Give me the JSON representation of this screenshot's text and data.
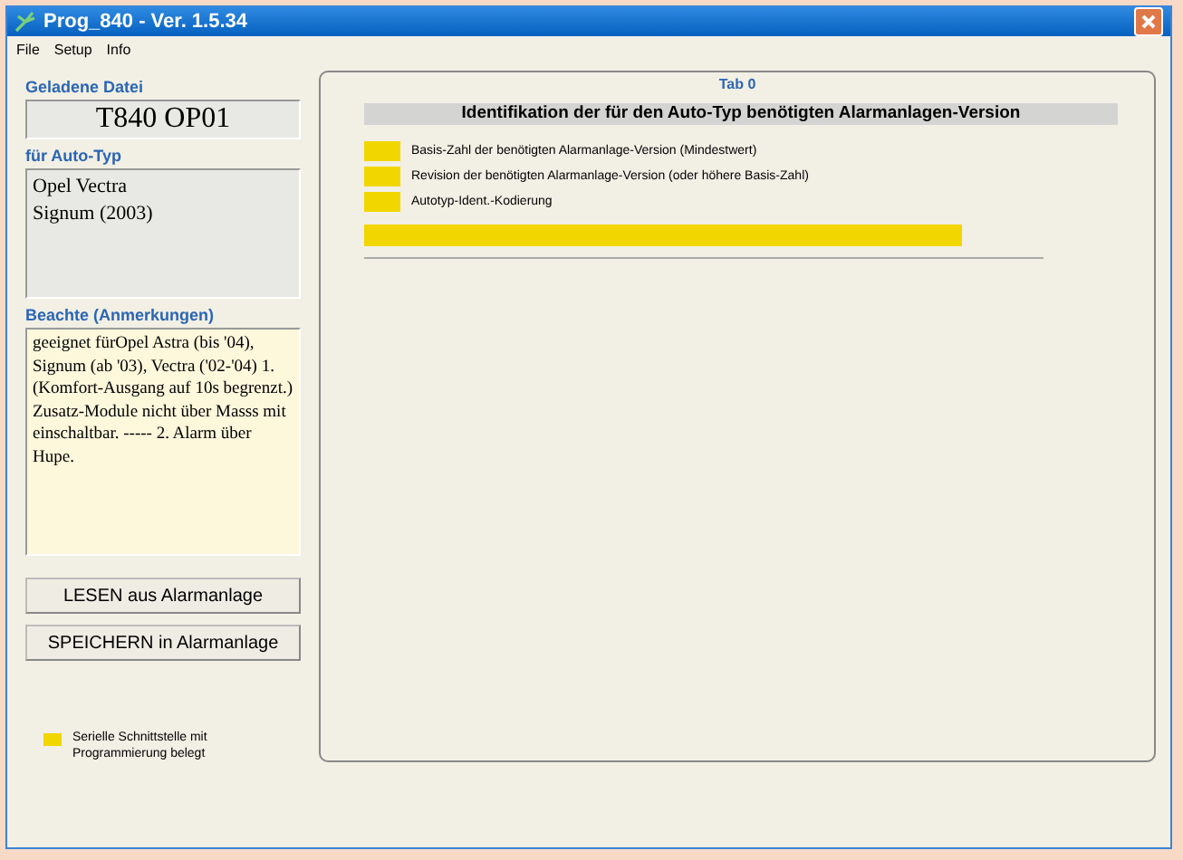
{
  "window": {
    "title": "Prog_840 - Ver. 1.5.34"
  },
  "menu": [
    "File",
    "Setup",
    "Info"
  ],
  "left": {
    "file_label": "Geladene Datei",
    "file_value": "T840 OP01",
    "type_label": "für Auto-Typ",
    "type_lines": [
      "Opel Vectra",
      "Signum (2003)"
    ],
    "notes_label": "Beachte (Anmerkungen)",
    "notes": "geeignet fürOpel Astra (bis  '04), Signum  (ab '03), Vectra ('02-'04) 1. (Komfort-Ausgang auf 10s begrenzt.) Zusatz-Module nicht über Masss mit einschaltbar. ----- 2. Alarm über Hupe.",
    "buttons": [
      "LESEN aus Alarmanlage",
      "SPEICHERN in Alarmanlage"
    ],
    "legend": {
      "color": "#f2d600",
      "text": "Serielle Schnittstelle mit Programmierung belegt"
    }
  },
  "tab": {
    "title": "Tab 0",
    "heading": "Identifikation der für den Auto-Typ benötigten Alarmanlagen-Version",
    "rows": [
      {
        "label": "Basis-Zahl der benötigten Alarmanlage-Version (Mindestwert)"
      },
      {
        "label": "Revision der benötigten Alarmanlage-Version (oder höhere Basis-Zahl)"
      },
      {
        "label": "Autotyp-Ident.-Kodierung"
      }
    ]
  }
}
